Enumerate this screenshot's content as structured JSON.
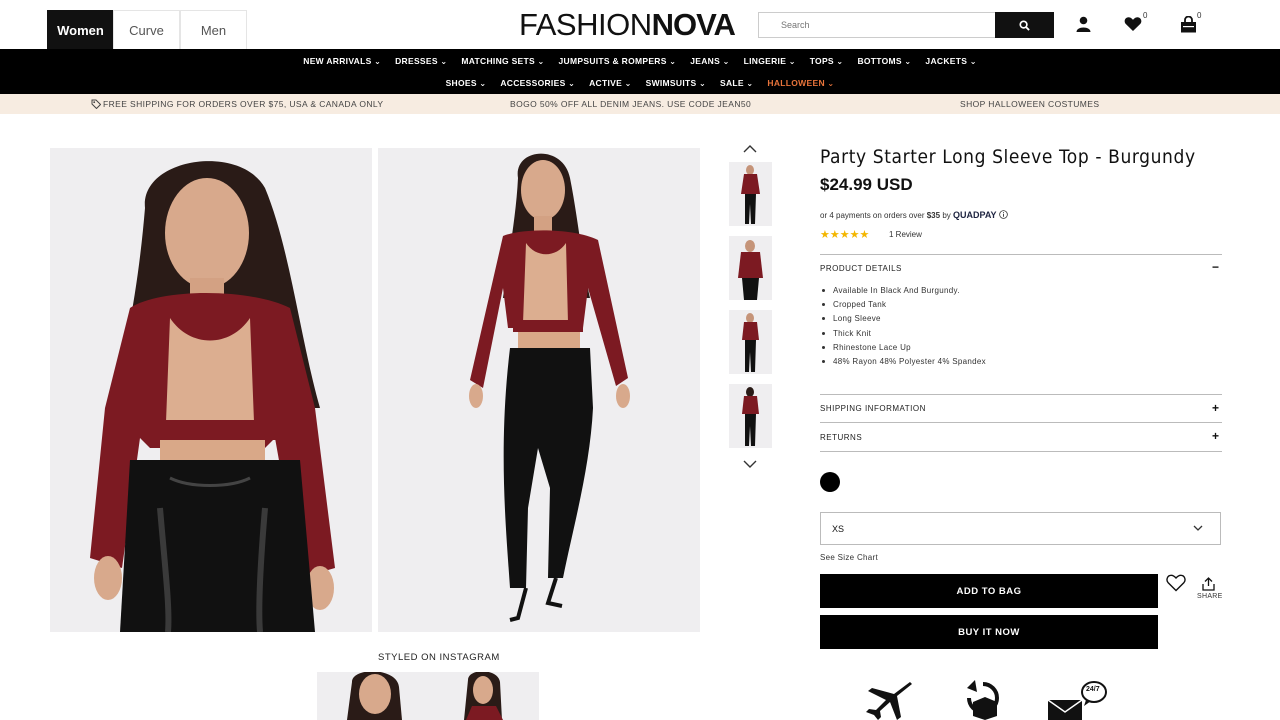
{
  "gender_tabs": [
    {
      "label": "Women",
      "active": true
    },
    {
      "label": "Curve",
      "active": false
    },
    {
      "label": "Men",
      "active": false
    }
  ],
  "logo": {
    "part1": "FASHION",
    "part2": "NOVA"
  },
  "search": {
    "placeholder": "Search"
  },
  "header": {
    "wishlist_count": "0",
    "bag_count": "0"
  },
  "nav": {
    "row1": [
      "NEW ARRIVALS",
      "DRESSES",
      "MATCHING SETS",
      "JUMPSUITS & ROMPERS",
      "JEANS",
      "LINGERIE",
      "TOPS",
      "BOTTOMS",
      "JACKETS"
    ],
    "row2": [
      "SHOES",
      "ACCESSORIES",
      "ACTIVE",
      "SWIMSUITS",
      "SALE",
      "HALLOWEEN"
    ]
  },
  "promo": {
    "left": "FREE SHIPPING FOR ORDERS OVER $75, USA & CANADA ONLY",
    "center": "BOGO 50% OFF ALL DENIM JEANS. USE CODE JEAN50",
    "right": "SHOP HALLOWEEN COSTUMES"
  },
  "product": {
    "title": "Party Starter Long Sleeve Top - Burgundy",
    "price": "$24.99 USD",
    "installments_prefix": "or 4 payments on orders over",
    "installments_min": "$35",
    "installments_by": "by",
    "installments_brand": "QUADPAY",
    "rating": "★★★★★",
    "reviews": "1 Review",
    "details_heading": "PRODUCT DETAILS",
    "details": [
      "Available In Black And Burgundy.",
      "Cropped Tank",
      "Long Sleeve",
      "Thick Knit",
      "Rhinestone Lace Up",
      "48% Rayon 48% Polyester 4% Spandex"
    ],
    "shipping_heading": "SHIPPING INFORMATION",
    "returns_heading": "RETURNS",
    "selected_size": "XS",
    "size_chart": "See Size Chart",
    "add_to_bag": "ADD TO BAG",
    "buy_now": "BUY IT NOW",
    "share": "SHARE",
    "badge_247": "24/7"
  },
  "styled_on_instagram": "STYLED ON INSTAGRAM",
  "colors": {
    "burgundy": "#7c1a22",
    "promo_bg": "#f7ece1",
    "halloween": "#e8743b",
    "star": "#f3b600"
  }
}
